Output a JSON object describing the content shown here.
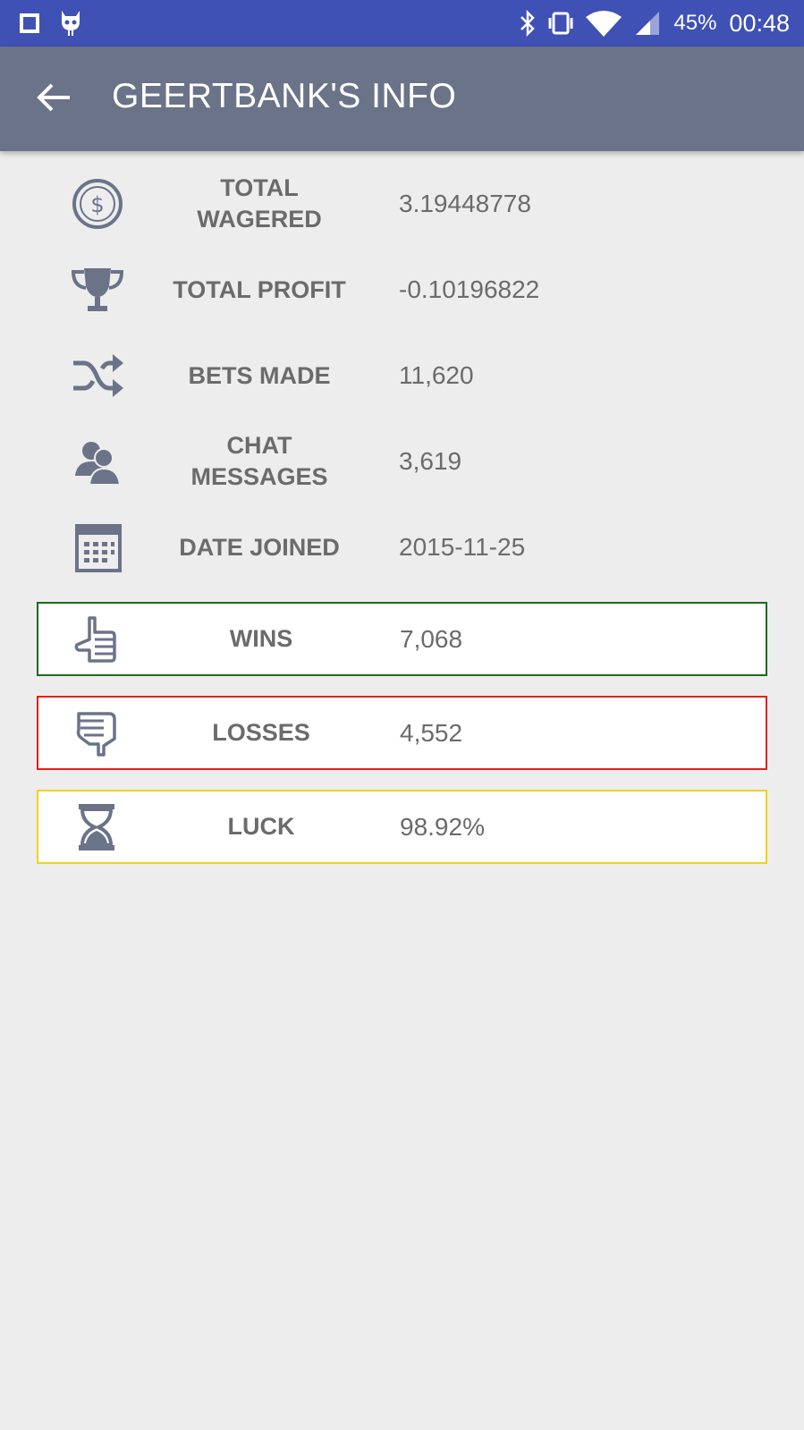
{
  "status": {
    "battery": "45%",
    "time": "00:48"
  },
  "appbar": {
    "title": "GEERTBANK'S INFO"
  },
  "stats": [
    {
      "label": "TOTAL WAGERED",
      "value": "3.19448778",
      "icon": "dollar-circle-icon"
    },
    {
      "label": "TOTAL PROFIT",
      "value": "-0.10196822",
      "icon": "trophy-icon"
    },
    {
      "label": "BETS MADE",
      "value": "11,620",
      "icon": "shuffle-icon"
    },
    {
      "label": "CHAT MESSAGES",
      "value": "3,619",
      "icon": "users-icon"
    },
    {
      "label": "DATE JOINED",
      "value": "2015-11-25",
      "icon": "calendar-icon"
    }
  ],
  "highlights": {
    "wins": {
      "label": "WINS",
      "value": "7,068",
      "color": "#1b6b1b",
      "icon": "thumb-up-hand-icon"
    },
    "losses": {
      "label": "LOSSES",
      "value": "4,552",
      "color": "#e02020",
      "icon": "thumb-down-hand-icon"
    },
    "luck": {
      "label": "LUCK",
      "value": "98.92%",
      "color": "#f2d21b",
      "icon": "hourglass-icon"
    }
  },
  "colors": {
    "statusbar": "#3f51b5",
    "appbar": "#6b7389",
    "icon": "#6b7389",
    "text": "#6b6b6b"
  }
}
